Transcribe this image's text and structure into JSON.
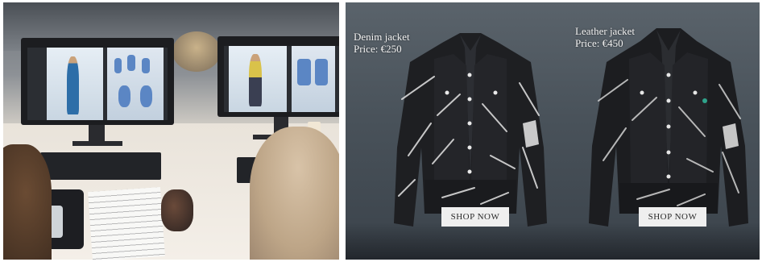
{
  "left_photo": {
    "alt_scene": ""
  },
  "products": [
    {
      "name": "Denim jacket",
      "price": "Price: €250",
      "cta": "SHOP NOW"
    },
    {
      "name": "Leather jacket",
      "price": "Price: €450",
      "cta": "SHOP NOW"
    }
  ],
  "colors": {
    "background_right": "#4a535b",
    "jacket_body": "#1e1f22",
    "button_bg": "#efefef"
  }
}
